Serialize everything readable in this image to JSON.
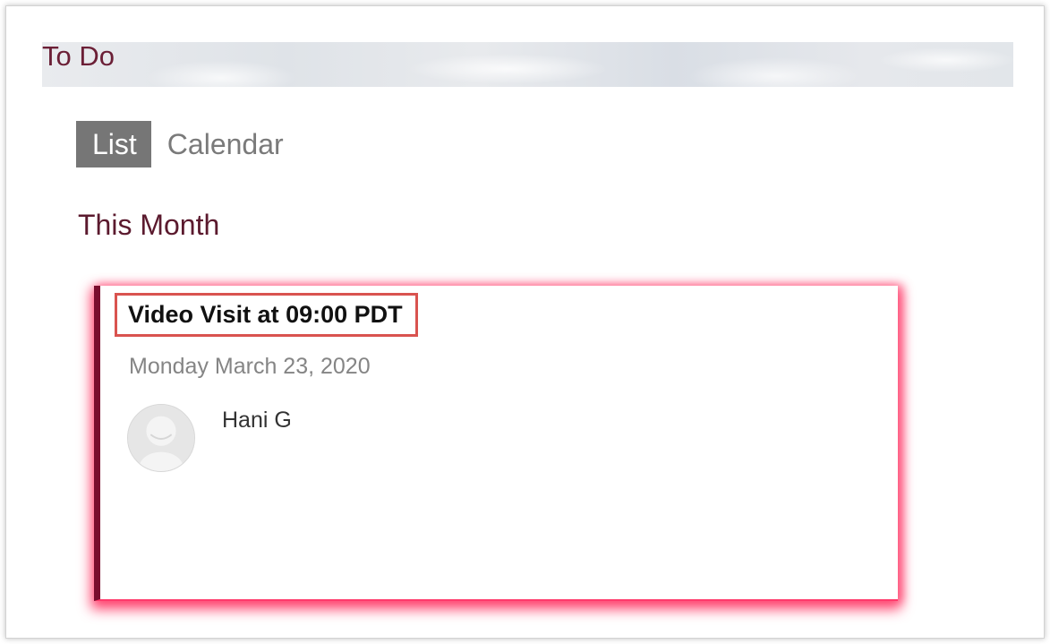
{
  "header": {
    "title": "To Do"
  },
  "tabs": [
    {
      "label": "List",
      "active": true
    },
    {
      "label": "Calendar",
      "active": false
    }
  ],
  "section": {
    "title": "This Month"
  },
  "appointment": {
    "title": "Video Visit at 09:00 PDT",
    "date": "Monday March 23, 2020",
    "person": "Hani G",
    "avatar_icon": "user-avatar-icon"
  },
  "colors": {
    "brand_maroon": "#6b1f36",
    "card_accent": "#7a0d2e",
    "glow": "#ff2a5a",
    "highlight_box": "#d9534f",
    "active_tab_bg": "#767676"
  }
}
